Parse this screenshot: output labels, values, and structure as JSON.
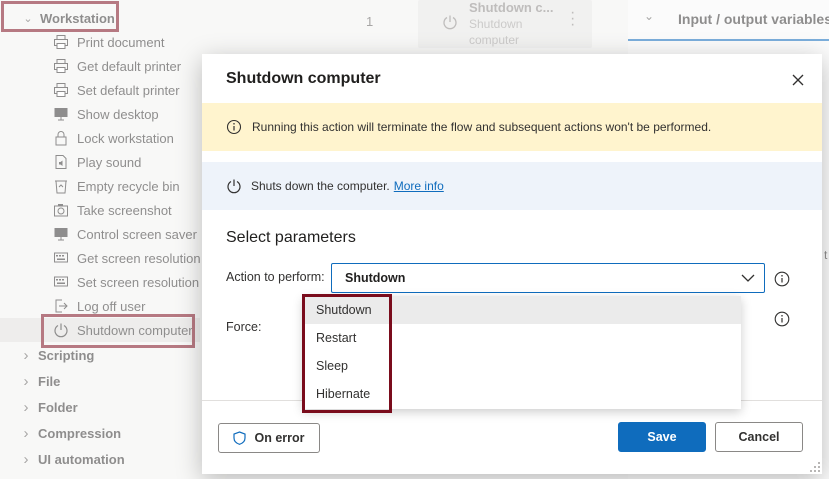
{
  "sidebar": {
    "workstation_label": "Workstation",
    "items": [
      {
        "label": "Print document",
        "icon": "printer-icon"
      },
      {
        "label": "Get default printer",
        "icon": "printer-icon"
      },
      {
        "label": "Set default printer",
        "icon": "printer-icon"
      },
      {
        "label": "Show desktop",
        "icon": "monitor-icon"
      },
      {
        "label": "Lock workstation",
        "icon": "lock-icon"
      },
      {
        "label": "Play sound",
        "icon": "sound-file-icon"
      },
      {
        "label": "Empty recycle bin",
        "icon": "recycle-bin-icon"
      },
      {
        "label": "Take screenshot",
        "icon": "camera-icon"
      },
      {
        "label": "Control screen saver",
        "icon": "monitor-icon"
      },
      {
        "label": "Get screen resolution",
        "icon": "keyboard-icon"
      },
      {
        "label": "Set screen resolution",
        "icon": "keyboard-icon"
      },
      {
        "label": "Log off user",
        "icon": "logoff-icon"
      },
      {
        "label": "Shutdown computer",
        "icon": "power-icon"
      }
    ],
    "categories": [
      "Scripting",
      "File",
      "Folder",
      "Compression",
      "UI automation"
    ]
  },
  "flow": {
    "step_number": "1",
    "step_title": "Shutdown c...",
    "step_subtitle_line1": "Shutdown",
    "step_subtitle_line2": "computer"
  },
  "right_panel": {
    "title": "Input / output variables",
    "partial_char": "t"
  },
  "dialog": {
    "title": "Shutdown computer",
    "warning_text": "Running this action will terminate the flow and subsequent actions won't be performed.",
    "info_text": "Shuts down the computer.",
    "more_info_link": "More info",
    "section_title": "Select parameters",
    "action_label": "Action to perform:",
    "action_value": "Shutdown",
    "force_label": "Force:",
    "options": [
      "Shutdown",
      "Restart",
      "Sleep",
      "Hibernate"
    ],
    "on_error_label": "On error",
    "save_label": "Save",
    "cancel_label": "Cancel"
  },
  "colors": {
    "accent": "#0f6cbd",
    "highlight_border": "#7a0c1c",
    "warning_bg": "#fff4ce",
    "info_bg": "#eef3fa"
  }
}
